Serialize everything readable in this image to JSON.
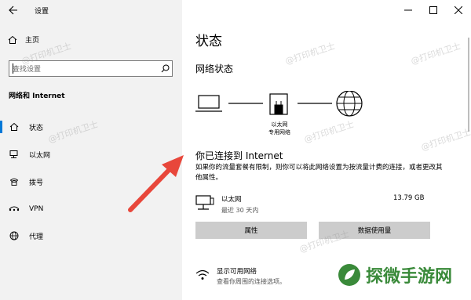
{
  "app": {
    "title": "设置"
  },
  "sidebar": {
    "home_label": "主页",
    "search_placeholder": "查找设置",
    "section_heading": "网络和 Internet",
    "items": [
      {
        "label": "状态",
        "icon": "home-status-icon",
        "active": true
      },
      {
        "label": "以太网",
        "icon": "ethernet-icon",
        "active": false
      },
      {
        "label": "拨号",
        "icon": "dialup-icon",
        "active": false
      },
      {
        "label": "VPN",
        "icon": "vpn-icon",
        "active": false
      },
      {
        "label": "代理",
        "icon": "globe-icon",
        "active": false
      }
    ]
  },
  "main": {
    "page_title": "状态",
    "section_title": "网络状态",
    "device_label_line1": "以太网",
    "device_label_line2": "专用网络",
    "connected_title": "你已连接到 Internet",
    "description": "如果你的流量套餐有限制，则你可以将此网络设置为按流量计费的连接，或者更改其他属性。",
    "network": {
      "name": "以太网",
      "subtitle": "最近 30 天内",
      "usage": "13.79 GB"
    },
    "buttons": {
      "properties": "属性",
      "data_usage": "数据使用量"
    },
    "available": {
      "title": "显示可用网络",
      "subtitle": "查看你周围的连接选项。"
    }
  },
  "watermarks": {
    "text": "@打印机卫士",
    "brand": "探微手游网"
  },
  "colors": {
    "accent": "#0078d7",
    "arrow": "#e8473b",
    "button_bg": "#cccccc",
    "sidebar_bg": "#f2f2f2"
  }
}
